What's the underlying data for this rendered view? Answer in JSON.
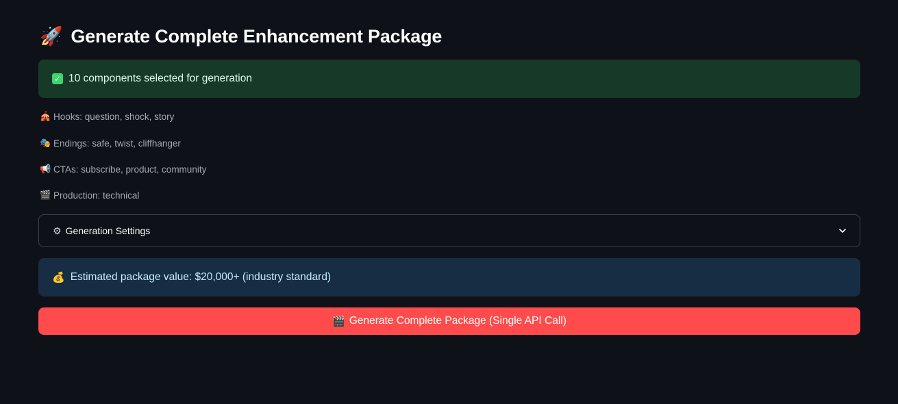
{
  "page": {
    "title": "Generate Complete Enhancement Package",
    "title_icon": "🚀"
  },
  "success_alert": {
    "icon": "✓",
    "text": "10 components selected for generation"
  },
  "summary": [
    {
      "icon": "🎪",
      "text": "Hooks: question, shock, story"
    },
    {
      "icon": "🎭",
      "text": "Endings: safe, twist, cliffhanger"
    },
    {
      "icon": "📢",
      "text": "CTAs: subscribe, product, community"
    },
    {
      "icon": "🎬",
      "text": "Production: technical"
    }
  ],
  "settings_expander": {
    "icon": "⚙",
    "label": "Generation Settings"
  },
  "info_alert": {
    "icon": "💰",
    "text": "Estimated package value: $20,000+ (industry standard)"
  },
  "generate_button": {
    "icon": "🎬",
    "label": "Generate Complete Package (Single API Call)"
  },
  "colors": {
    "background": "#0e1117",
    "success_bg": "#173928",
    "info_bg": "#172d43",
    "primary": "#ff4b4b"
  }
}
